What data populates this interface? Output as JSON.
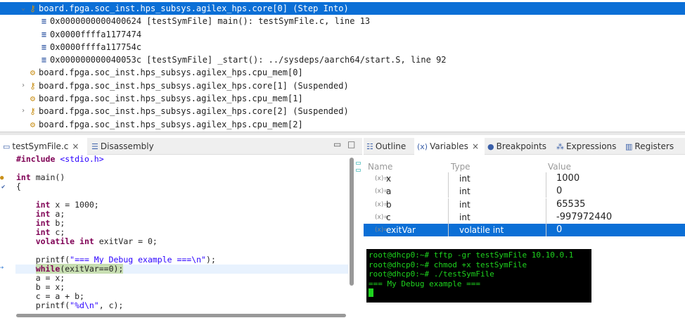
{
  "debug_tree": [
    {
      "label": "board.fpga.soc_inst.hps_subsys.agilex_hps.core[0] (Step Into)",
      "type": "thread",
      "expanded": true,
      "selected": true
    },
    {
      "label": "0x0000000000400624 [testSymFile] main(): testSymFile.c, line 13",
      "type": "frame"
    },
    {
      "label": "0x0000ffffa1177474",
      "type": "frame"
    },
    {
      "label": "0x0000ffffa117754c",
      "type": "frame"
    },
    {
      "label": "0x000000000040053c [testSymFile] _start(): ../sysdeps/aarch64/start.S, line 92",
      "type": "frame"
    },
    {
      "label": "board.fpga.soc_inst.hps_subsys.agilex_hps.cpu_mem[0]",
      "type": "mem"
    },
    {
      "label": "board.fpga.soc_inst.hps_subsys.agilex_hps.core[1] (Suspended)",
      "type": "thread",
      "expanded": false
    },
    {
      "label": "board.fpga.soc_inst.hps_subsys.agilex_hps.cpu_mem[1]",
      "type": "mem"
    },
    {
      "label": "board.fpga.soc_inst.hps_subsys.agilex_hps.core[2] (Suspended)",
      "type": "thread",
      "expanded": false
    },
    {
      "label": "board.fpga.soc_inst.hps_subsys.agilex_hps.cpu_mem[2]",
      "type": "mem"
    }
  ],
  "editor": {
    "tabs": [
      {
        "label": "testSymFile.c",
        "active": true
      },
      {
        "label": "Disassembly"
      }
    ],
    "close_glyph": "×",
    "lines": [
      "#include <stdio.h>",
      "",
      "int main()",
      "{",
      "",
      "    int x = 1000;",
      "    int a;",
      "    int b;",
      "    int c;",
      "    volatile int exitVar = 0;",
      "",
      "    printf(\"=== My Debug example ===\\n\");",
      "    while(exitVar==0);",
      "    a = x;",
      "    b = x;",
      "    c = a + b;",
      "    printf(\"%d\\n\", c);"
    ],
    "current_line_index": 12
  },
  "views": {
    "tabs": [
      {
        "label": "Outline"
      },
      {
        "label": "Variables",
        "active": true
      },
      {
        "label": "Breakpoints"
      },
      {
        "label": "Expressions"
      },
      {
        "label": "Registers"
      }
    ]
  },
  "variables": {
    "columns": [
      "Name",
      "Type",
      "Value"
    ],
    "rows": [
      {
        "name": "x",
        "type": "int",
        "value": "1000"
      },
      {
        "name": "a",
        "type": "int",
        "value": "0"
      },
      {
        "name": "b",
        "type": "int",
        "value": "65535"
      },
      {
        "name": "c",
        "type": "int",
        "value": "-997972440"
      },
      {
        "name": "exitVar",
        "type": "volatile int",
        "value": "0",
        "selected": true
      }
    ]
  },
  "terminal": {
    "lines": [
      "root@dhcp0:~# tftp -gr testSymFile 10.10.0.1",
      "root@dhcp0:~# chmod +x testSymFile",
      "root@dhcp0:~# ./testSymFile",
      "=== My Debug example ==="
    ]
  },
  "colors": {
    "selection": "#0b6fd6",
    "terminal_bg": "#000000",
    "terminal_fg": "#1ed41e",
    "keyword": "#7f0055",
    "string": "#2a00ff"
  }
}
